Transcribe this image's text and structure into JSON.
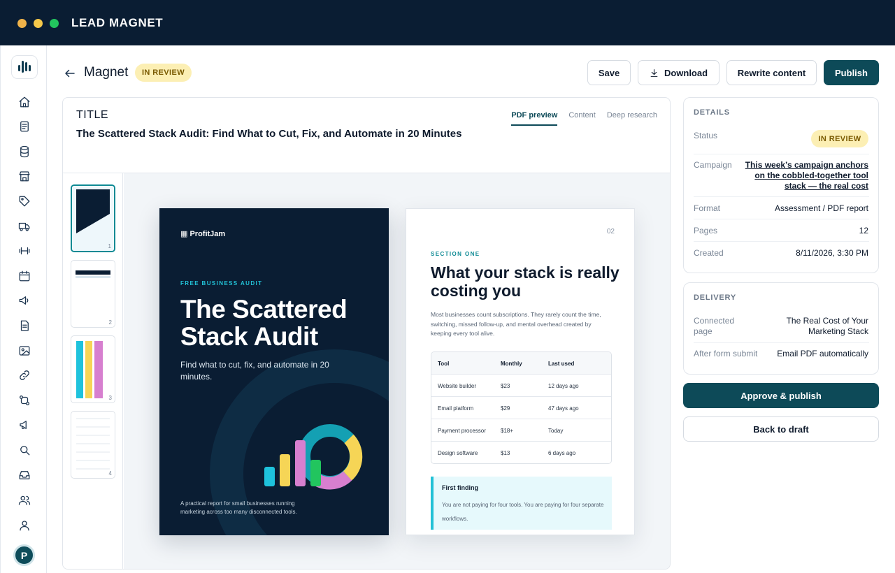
{
  "window": {
    "title": "LEAD MAGNET"
  },
  "header": {
    "back_label": "Back",
    "title": "Magnet",
    "status_badge": "IN REVIEW",
    "buttons": {
      "save": "Save",
      "download": "Download",
      "rewrite": "Rewrite content",
      "publish": "Publish"
    }
  },
  "editor": {
    "title_label": "TITLE",
    "title_value": "The Scattered Stack Audit: Find What to Cut, Fix, and Automate in 20 Minutes",
    "tabs": [
      {
        "label": "PDF preview",
        "active": true
      },
      {
        "label": "Content",
        "active": false
      },
      {
        "label": "Deep research",
        "active": false
      }
    ],
    "thumbnails": [
      {
        "page": "1"
      },
      {
        "page": "2"
      },
      {
        "page": "3"
      },
      {
        "page": "4"
      }
    ]
  },
  "pdf": {
    "cover": {
      "brand": "ProfitJam",
      "kicker": "FREE BUSINESS AUDIT",
      "title": "The Scattered Stack Audit",
      "subtitle": "Find what to cut, fix, and automate in 20 minutes.",
      "footer": "A practical report for small businesses running marketing across too many disconnected tools.",
      "colors": {
        "cyan": "#1ec2dc",
        "yellow": "#f6d556",
        "pink": "#d77fcf",
        "green": "#22c55e",
        "teal": "#14a0b3"
      }
    },
    "page2": {
      "page_number": "02",
      "kicker": "SECTION ONE",
      "title": "What your stack is really costing you",
      "body": "Most businesses count subscriptions. They rarely count the time, switching, missed follow-up, and mental overhead created by keeping every tool alive.",
      "table": {
        "headers": [
          "Tool",
          "Monthly",
          "Last used"
        ],
        "rows": [
          [
            "Website builder",
            "$23",
            "12 days ago"
          ],
          [
            "Email platform",
            "$29",
            "47 days ago"
          ],
          [
            "Payment processor",
            "$18+",
            "Today"
          ],
          [
            "Design software",
            "$13",
            "6 days ago"
          ]
        ]
      },
      "finding": {
        "title": "First finding",
        "body": "You are not paying for four tools. You are paying for four separate workflows."
      }
    }
  },
  "details": {
    "heading": "DETAILS",
    "status_label": "Status",
    "status_value": "IN REVIEW",
    "campaign_label": "Campaign",
    "campaign_value": "This week’s campaign anchors on the cobbled-together tool stack — the real cost",
    "format_label": "Format",
    "format_value": "Assessment / PDF report",
    "pages_label": "Pages",
    "pages_value": "12",
    "created_label": "Created",
    "created_value": "8/11/2026, 3:30 PM"
  },
  "delivery": {
    "heading": "DELIVERY",
    "connected_label": "Connected page",
    "connected_value": "The Real Cost of Your Marketing Stack",
    "after_label": "After form submit",
    "after_value": "Email PDF automatically"
  },
  "actions": {
    "approve": "Approve & publish",
    "back_to_draft": "Back to draft"
  },
  "user": {
    "avatar_initial": "P"
  },
  "icons": {
    "rail": [
      "home-icon",
      "document-icon",
      "database-icon",
      "store-icon",
      "tag-icon",
      "truck-icon",
      "fitness-icon",
      "calendar-icon",
      "megaphone-icon",
      "file-icon",
      "image-icon",
      "link-icon",
      "workflow-icon",
      "announce-icon",
      "search-icon",
      "inbox-icon",
      "users-icon",
      "user-icon"
    ]
  },
  "colors": {
    "navy": "#0a1d33",
    "primary": "#0d4a58",
    "badge_bg": "#fcefb4",
    "badge_text": "#7a5a00",
    "accent_cyan": "#22c1d6"
  }
}
